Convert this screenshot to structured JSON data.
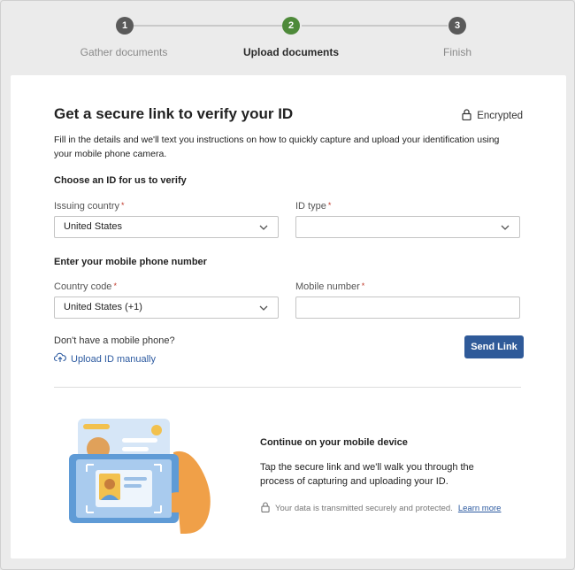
{
  "stepper": {
    "steps": [
      {
        "number": "1",
        "label": "Gather documents",
        "color": "#5a5a5a"
      },
      {
        "number": "2",
        "label": "Upload documents",
        "color": "#4e8a3a"
      },
      {
        "number": "3",
        "label": "Finish",
        "color": "#5a5a5a"
      }
    ]
  },
  "card": {
    "title": "Get a secure link to verify your ID",
    "encrypted_label": "Encrypted",
    "description": "Fill in the details and we'll text you instructions on how to quickly capture and upload your identification using your mobile phone camera.",
    "id_section": {
      "heading": "Choose an ID for us to verify",
      "issuing_country_label": "Issuing country",
      "issuing_country_value": "United States",
      "id_type_label": "ID type",
      "id_type_value": ""
    },
    "phone_section": {
      "heading": "Enter your mobile phone number",
      "country_code_label": "Country code",
      "country_code_value": "United States (+1)",
      "mobile_number_label": "Mobile number",
      "mobile_number_value": ""
    },
    "required_mark": "*",
    "no_phone_text": "Don't have a mobile phone?",
    "upload_manual_link": "Upload ID manually",
    "send_link_button": "Send Link",
    "continue": {
      "heading": "Continue on your mobile device",
      "body": "Tap the secure link and we'll walk you through the process of capturing and uploading your ID.",
      "secure_note": "Your data is transmitted securely and protected.",
      "learn_more": "Learn more"
    }
  },
  "colors": {
    "primary": "#2f5a99",
    "link": "#2c5aa0",
    "active_step": "#4e8a3a",
    "required": "#c0392b"
  }
}
